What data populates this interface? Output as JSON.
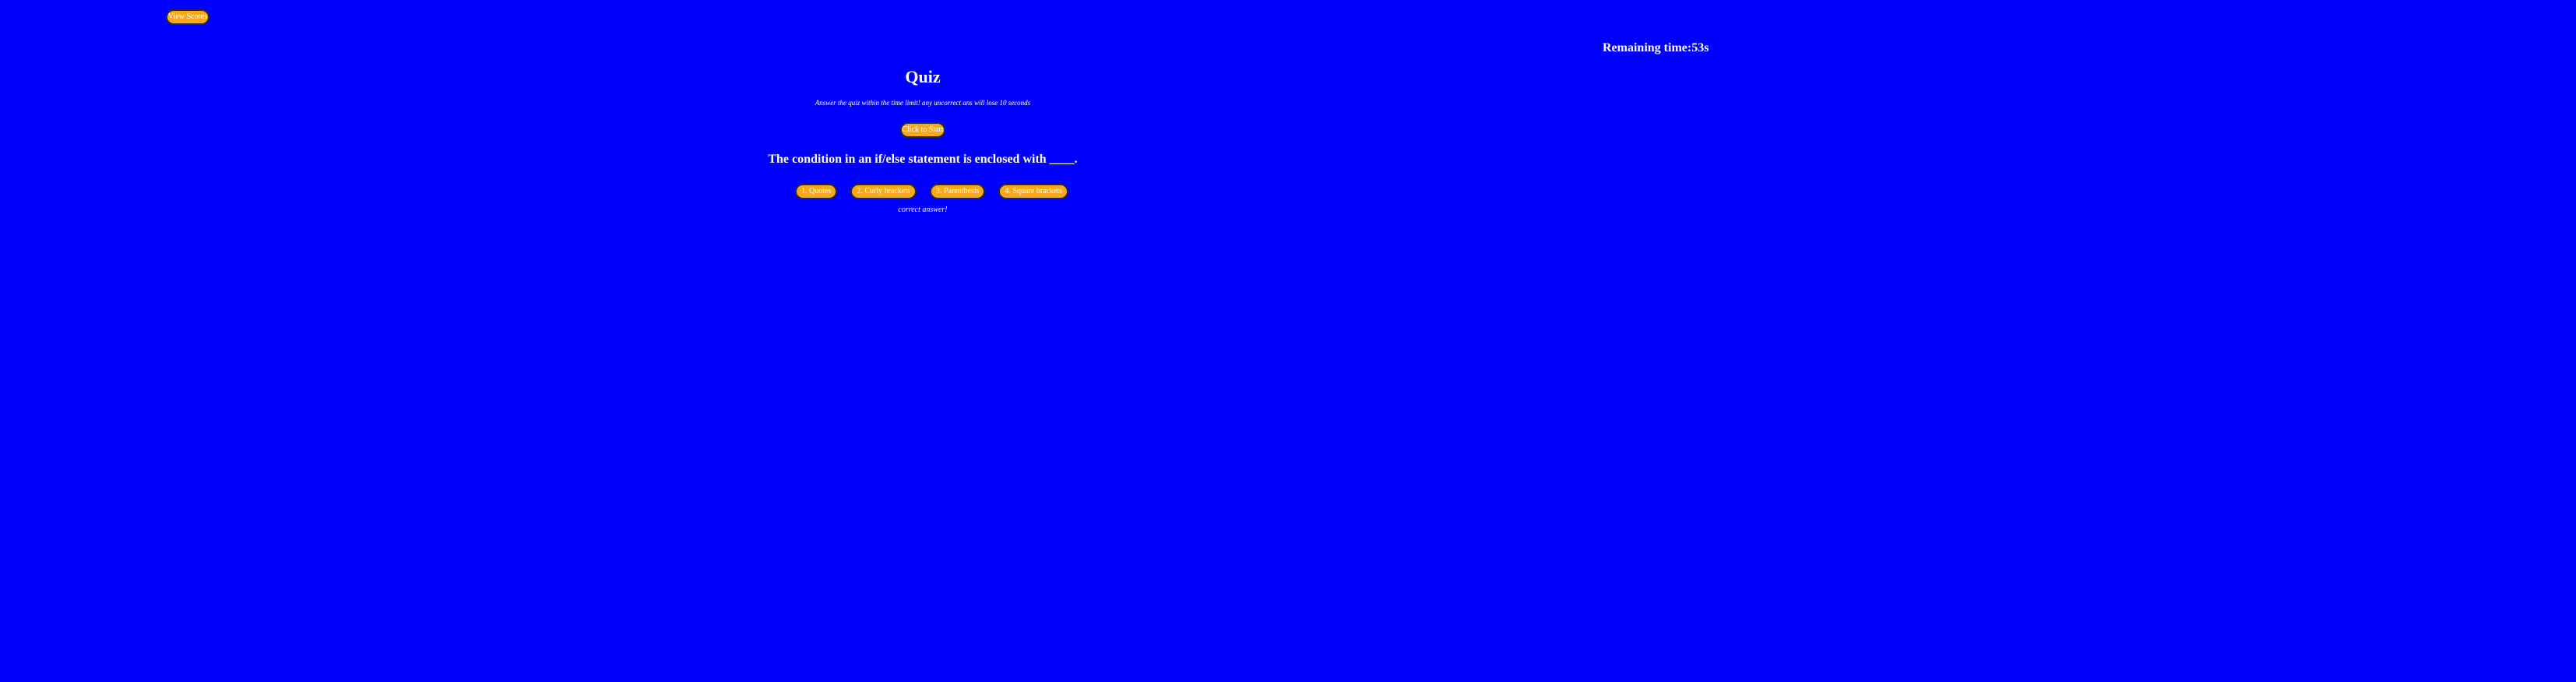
{
  "header": {
    "highscore_label": "View Scores",
    "timer_text": "Remaining time:53s"
  },
  "quiz": {
    "title": "Quiz",
    "instructions": "Answer the quiz within the time limit! any uncorrect ans will lose 10 seconds",
    "start_label": "Click to Start",
    "question": "The condition in an if/else statement is enclosed with ____.",
    "answers": [
      {
        "label": "1. Quotes"
      },
      {
        "label": "2. Curly brackets"
      },
      {
        "label": "3. Parenthesis"
      },
      {
        "label": "4. Square brackets"
      }
    ],
    "feedback": "correct answer!"
  },
  "colors": {
    "background": "#0000ff",
    "button": "#f8a81c",
    "button_border": "#2a2a2a",
    "text": "#ffffff"
  }
}
